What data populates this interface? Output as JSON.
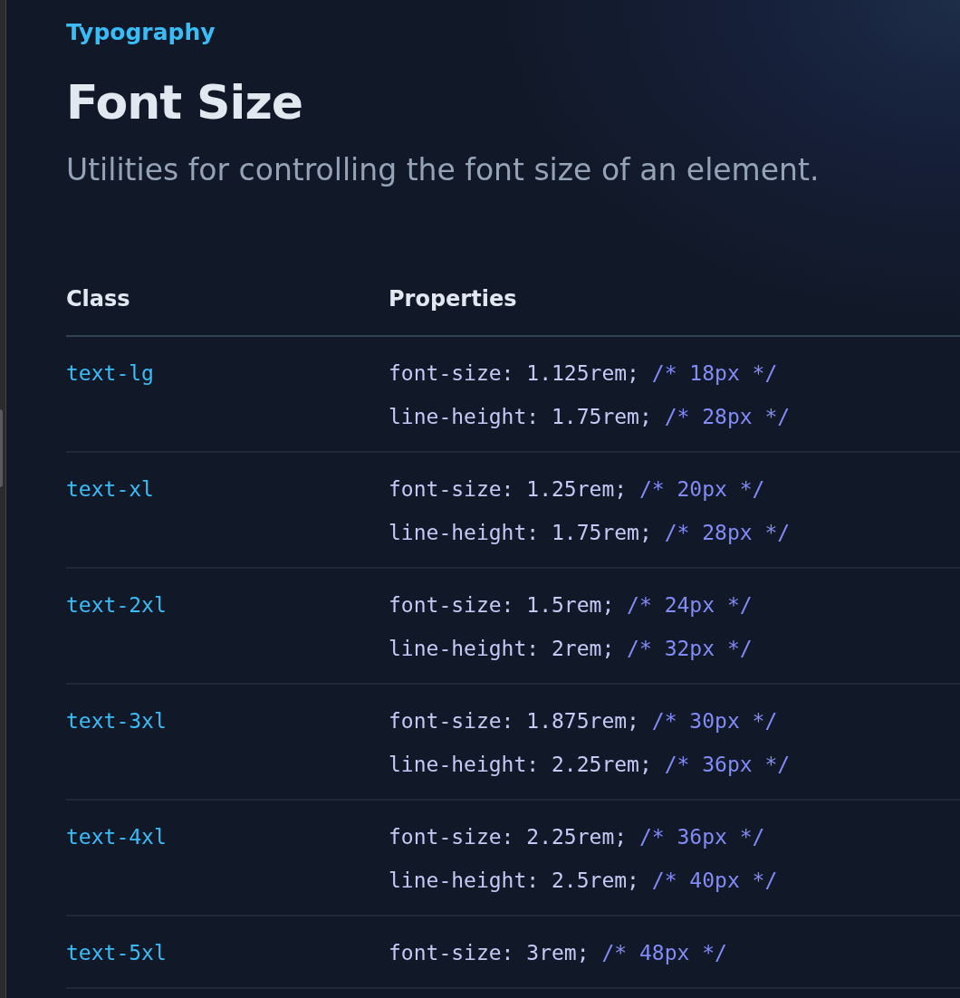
{
  "eyebrow": "Typography",
  "title": "Font Size",
  "description": "Utilities for controlling the font size of an element.",
  "table": {
    "columns": [
      "Class",
      "Properties"
    ],
    "rows": [
      {
        "class": "text-lg",
        "properties": [
          {
            "declaration": "font-size: 1.125rem;",
            "comment": "/* 18px */"
          },
          {
            "declaration": "line-height: 1.75rem;",
            "comment": "/* 28px */"
          }
        ]
      },
      {
        "class": "text-xl",
        "properties": [
          {
            "declaration": "font-size: 1.25rem;",
            "comment": "/* 20px */"
          },
          {
            "declaration": "line-height: 1.75rem;",
            "comment": "/* 28px */"
          }
        ]
      },
      {
        "class": "text-2xl",
        "properties": [
          {
            "declaration": "font-size: 1.5rem;",
            "comment": "/* 24px */"
          },
          {
            "declaration": "line-height: 2rem;",
            "comment": "/* 32px */"
          }
        ]
      },
      {
        "class": "text-3xl",
        "properties": [
          {
            "declaration": "font-size: 1.875rem;",
            "comment": "/* 30px */"
          },
          {
            "declaration": "line-height: 2.25rem;",
            "comment": "/* 36px */"
          }
        ]
      },
      {
        "class": "text-4xl",
        "properties": [
          {
            "declaration": "font-size: 2.25rem;",
            "comment": "/* 36px */"
          },
          {
            "declaration": "line-height: 2.5rem;",
            "comment": "/* 40px */"
          }
        ]
      },
      {
        "class": "text-5xl",
        "properties": [
          {
            "declaration": "font-size: 3rem;",
            "comment": "/* 48px */"
          }
        ]
      }
    ]
  }
}
